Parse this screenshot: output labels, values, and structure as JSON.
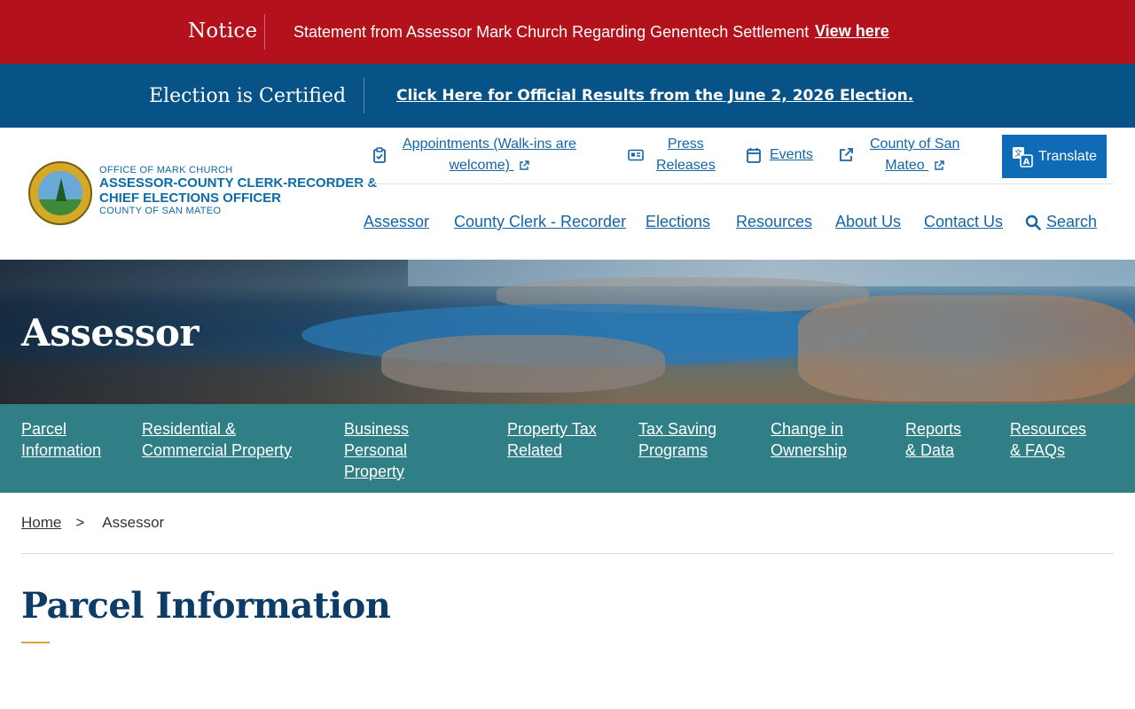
{
  "notice": {
    "label": "Notice",
    "text": "Statement from Assessor Mark Church Regarding Genentech Settlement",
    "link": "View here"
  },
  "election": {
    "label": "Election is Certified",
    "link": "Click Here for Official Results from the June 2, 2026 Election."
  },
  "logo": {
    "line1": "OFFICE OF MARK CHURCH",
    "line2": "ASSESSOR-COUNTY CLERK-RECORDER &",
    "line3": "CHIEF ELECTIONS OFFICER",
    "line4": "COUNTY OF SAN MATEO",
    "seal_icon": "county-seal-icon"
  },
  "utility_links": {
    "appointments_line1": "Appointments (Walk-ins are",
    "appointments_line2": "welcome)",
    "press_line1": "Press",
    "press_line2": "Releases",
    "events": "Events",
    "county_line1": "County of San",
    "county_line2": "Mateo"
  },
  "translate_label": "Translate",
  "main_nav": {
    "assessor": "Assessor",
    "clerk_recorder": "County Clerk - Recorder",
    "elections": "Elections",
    "resources": "Resources",
    "about": "About Us",
    "contact": "Contact Us",
    "search": "Search"
  },
  "hero": {
    "title": "Assessor"
  },
  "sub_nav": [
    {
      "line1": "Parcel",
      "line2": "Information",
      "line3": ""
    },
    {
      "line1": "Residential &",
      "line2": "Commercial Property",
      "line3": ""
    },
    {
      "line1": "Business",
      "line2": "Personal",
      "line3": "Property"
    },
    {
      "line1": "Property Tax",
      "line2": "Related",
      "line3": ""
    },
    {
      "line1": "Tax Saving",
      "line2": "Programs",
      "line3": ""
    },
    {
      "line1": "Change in",
      "line2": "Ownership",
      "line3": ""
    },
    {
      "line1": "Reports",
      "line2": "& Data",
      "line3": ""
    },
    {
      "line1": "Resources",
      "line2": "& FAQs",
      "line3": ""
    }
  ],
  "breadcrumb": {
    "home": "Home",
    "separator": ">",
    "current": "Assessor"
  },
  "page_title": "Parcel Information",
  "colors": {
    "notice_bg": "#b3121c",
    "election_bg": "#075387",
    "link_blue": "#1565a6",
    "translate_bg": "#0f6bb5",
    "subnav_bg": "#307e86",
    "title_navy": "#0d3d66",
    "accent_gold": "#d8a33a"
  }
}
